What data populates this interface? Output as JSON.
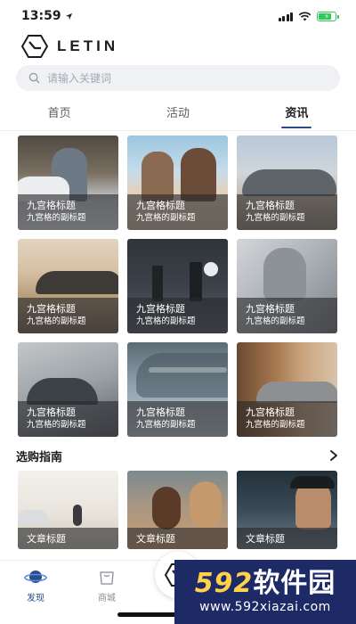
{
  "status_bar": {
    "time": "13:59",
    "battery_color": "#34c759"
  },
  "brand": {
    "name": "LETIN"
  },
  "search": {
    "placeholder": "请输入关键词"
  },
  "tabs": [
    {
      "label": "首页",
      "active": false
    },
    {
      "label": "活动",
      "active": false
    },
    {
      "label": "资讯",
      "active": true
    }
  ],
  "grid_tiles": [
    {
      "title": "九宫格标题",
      "subtitle": "九宫格的副标题"
    },
    {
      "title": "九宫格标题",
      "subtitle": "九宫格的副标题"
    },
    {
      "title": "九宫格标题",
      "subtitle": "九宫格的副标题"
    },
    {
      "title": "九宫格标题",
      "subtitle": "九宫格的副标题"
    },
    {
      "title": "九宫格标题",
      "subtitle": "九宫格的副标题"
    },
    {
      "title": "九宫格标题",
      "subtitle": "九宫格的副标题"
    },
    {
      "title": "九宫格标题",
      "subtitle": "九宫格的副标题"
    },
    {
      "title": "九宫格标题",
      "subtitle": "九宫格的副标题"
    },
    {
      "title": "九宫格标题",
      "subtitle": "九宫格的副标题"
    }
  ],
  "buying_guide": {
    "title": "选购指南",
    "articles": [
      {
        "title": "文章标题"
      },
      {
        "title": "文章标题"
      },
      {
        "title": "文章标题"
      }
    ]
  },
  "bottom_nav": {
    "items": [
      {
        "label": "发现",
        "active": true
      },
      {
        "label": "商城",
        "active": false
      }
    ]
  },
  "watermark": {
    "number": "592",
    "text": "软件园",
    "url": "www.592xiazai.com"
  },
  "colors": {
    "accent": "#2b4b8c",
    "watermark_bg": "#1e2a66",
    "watermark_number": "#ffd24a"
  }
}
